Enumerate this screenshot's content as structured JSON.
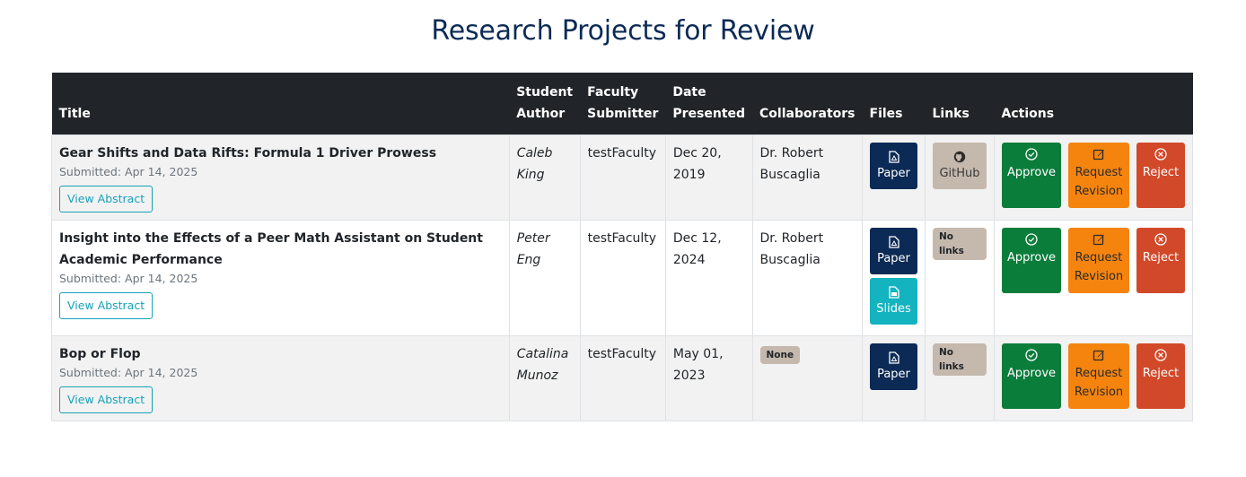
{
  "page_title": "Research Projects for Review",
  "headers": {
    "title": "Title",
    "student_author": "Student Author",
    "faculty_submitter": "Faculty Submitter",
    "date_presented": "Date Presented",
    "collaborators": "Collaborators",
    "files": "Files",
    "links": "Links",
    "actions": "Actions"
  },
  "buttons": {
    "view_abstract": "View Abstract",
    "approve": "Approve",
    "request_revision": "Request Revision",
    "reject": "Reject",
    "paper": "Paper",
    "slides": "Slides",
    "github": "GitHub",
    "no_links": "No links"
  },
  "colors": {
    "header_bg": "#212529",
    "title_color": "#0b2a55",
    "approve": "#0b7d3b",
    "revise": "#f5840f",
    "reject": "#d2492a",
    "paper": "#0b2a55",
    "slides": "#13b3bf",
    "badge": "#c5b8ad"
  },
  "rows": [
    {
      "title": "Gear Shifts and Data Rifts: Formula 1 Driver Prowess",
      "submitted": "Submitted: Apr 14, 2025",
      "author_first": "Caleb",
      "author_last": "King",
      "faculty": "testFaculty",
      "date_line1": "Dec 20,",
      "date_line2": "2019",
      "collab_line1": "Dr. Robert",
      "collab_line2": "Buscaglia"
    },
    {
      "title": "Insight into the Effects of a Peer Math Assistant on Student Academic Performance",
      "submitted": "Submitted: Apr 14, 2025",
      "author_first": "Peter",
      "author_last": "Eng",
      "faculty": "testFaculty",
      "date_line1": "Dec 12,",
      "date_line2": "2024",
      "collab_line1": "Dr. Robert",
      "collab_line2": "Buscaglia"
    },
    {
      "title": "Bop or Flop",
      "submitted": "Submitted: Apr 14, 2025",
      "author_first": "Catalina",
      "author_last": "Munoz",
      "faculty": "testFaculty",
      "date_line1": "May 01,",
      "date_line2": "2023",
      "collab_none": "None"
    }
  ]
}
